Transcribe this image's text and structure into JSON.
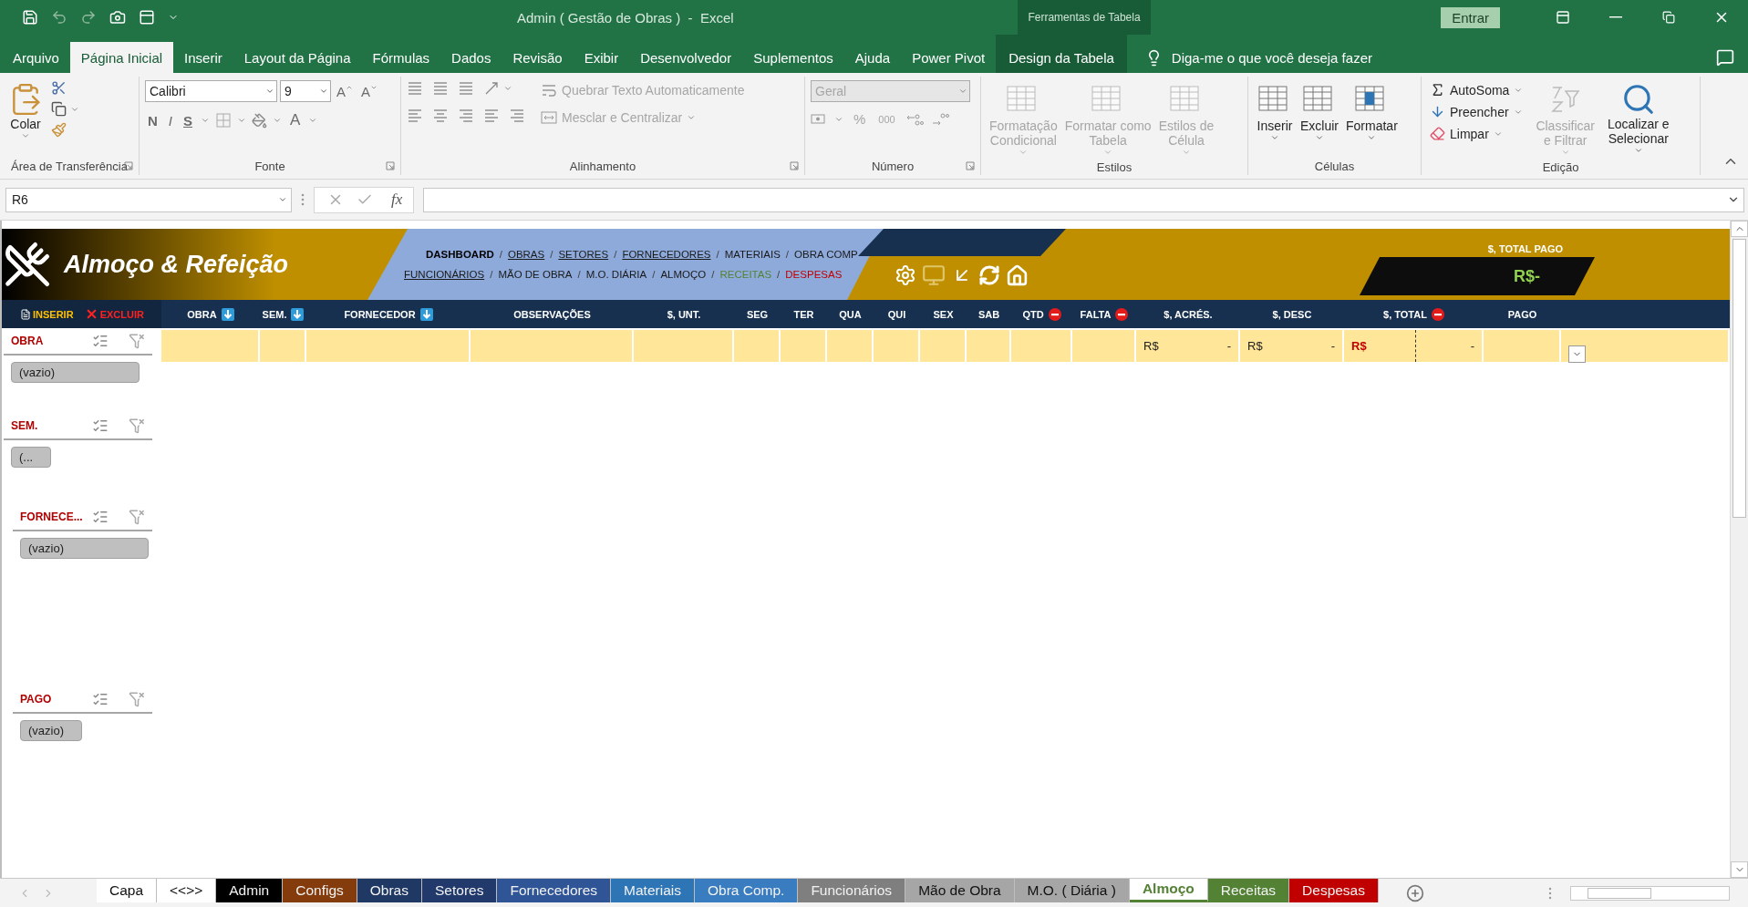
{
  "title_bar": {
    "title": "Admin ( Gestão de Obras )  -  Excel",
    "context_label": "Ferramentas de Tabela",
    "sign_in": "Entrar"
  },
  "menu_tabs": [
    {
      "label": "Arquivo",
      "selected": false,
      "kind": "normal"
    },
    {
      "label": "Página Inicial",
      "selected": true,
      "kind": "normal"
    },
    {
      "label": "Inserir",
      "selected": false,
      "kind": "normal"
    },
    {
      "label": "Layout da Página",
      "selected": false,
      "kind": "normal"
    },
    {
      "label": "Fórmulas",
      "selected": false,
      "kind": "normal"
    },
    {
      "label": "Dados",
      "selected": false,
      "kind": "normal"
    },
    {
      "label": "Revisão",
      "selected": false,
      "kind": "normal"
    },
    {
      "label": "Exibir",
      "selected": false,
      "kind": "normal"
    },
    {
      "label": "Desenvolvedor",
      "selected": false,
      "kind": "normal"
    },
    {
      "label": "Suplementos",
      "selected": false,
      "kind": "normal"
    },
    {
      "label": "Ajuda",
      "selected": false,
      "kind": "normal"
    },
    {
      "label": "Power Pivot",
      "selected": false,
      "kind": "normal"
    },
    {
      "label": "Design da Tabela",
      "selected": false,
      "kind": "contextual"
    }
  ],
  "tell_me": "Diga-me o que você deseja fazer",
  "ribbon": {
    "clipboard": {
      "paste": "Colar",
      "group": "Área de Transferência"
    },
    "font": {
      "font_name": "Calibri",
      "font_size": "9",
      "grow": "A",
      "shrink": "A",
      "bold": "N",
      "italic": "I",
      "underline": "S",
      "font_color": "A",
      "group": "Fonte"
    },
    "alignment": {
      "wrap": "Quebrar Texto Automaticamente",
      "merge": "Mesclar e Centralizar",
      "disabled": true,
      "group": "Alinhamento"
    },
    "number": {
      "format": "Geral",
      "percent": "%",
      "thousands": "000",
      "disabled": true,
      "group": "Número"
    },
    "styles": {
      "buttons": [
        {
          "lines": [
            "Formatação",
            "Condicional"
          ],
          "disabled": true
        },
        {
          "lines": [
            "Formatar como",
            "Tabela"
          ],
          "disabled": true
        },
        {
          "lines": [
            "Estilos de",
            "Célula"
          ],
          "disabled": true
        }
      ],
      "group": "Estilos"
    },
    "cells": {
      "buttons": [
        {
          "lines": [
            "Inserir"
          ],
          "disabled": false
        },
        {
          "lines": [
            "Excluir"
          ],
          "disabled": false
        },
        {
          "lines": [
            "Formatar"
          ],
          "disabled": false
        }
      ],
      "group": "Células"
    },
    "editing": {
      "small": [
        {
          "label": "AutoSoma"
        },
        {
          "label": "Preencher"
        },
        {
          "label": "Limpar"
        }
      ],
      "large": [
        {
          "lines": [
            "Classificar",
            "e Filtrar"
          ],
          "disabled": true
        },
        {
          "lines": [
            "Localizar e",
            "Selecionar"
          ],
          "disabled": false
        }
      ],
      "group": "Edição"
    }
  },
  "formula_bar": {
    "name_box": "R6",
    "fx": "fx"
  },
  "banner": {
    "title": "Almoço & Refeição",
    "nav_rows": [
      [
        {
          "label": "DASHBOARD",
          "underlined": false,
          "bold": true,
          "color": "#000000",
          "separator": "/"
        },
        {
          "label": "OBRAS",
          "underlined": true,
          "bold": false,
          "color": "#1a1a1a",
          "separator": "/"
        },
        {
          "label": "SETORES",
          "underlined": true,
          "bold": false,
          "color": "#1a1a1a",
          "separator": "/"
        },
        {
          "label": "FORNECEDORES",
          "underlined": true,
          "bold": false,
          "color": "#1a1a1a",
          "separator": "/"
        },
        {
          "label": "MATERIAIS",
          "underlined": false,
          "bold": false,
          "color": "#1a1a1a",
          "separator": "/"
        },
        {
          "label": "OBRA COMP",
          "underlined": false,
          "bold": false,
          "color": "#1a1a1a"
        }
      ],
      [
        {
          "label": "FUNCIONÁRIOS",
          "underlined": true,
          "bold": false,
          "color": "#1a1a1a",
          "separator": "/"
        },
        {
          "label": "MÃO DE OBRA",
          "underlined": false,
          "bold": false,
          "color": "#1a1a1a",
          "separator": "/"
        },
        {
          "label": "M.O. DIÁRIA",
          "underlined": false,
          "bold": false,
          "color": "#1a1a1a",
          "separator": "/"
        },
        {
          "label": "ALMOÇO",
          "underlined": false,
          "bold": false,
          "color": "#1a1a1a",
          "separator": "/"
        },
        {
          "label": "RECEITAS",
          "underlined": false,
          "bold": false,
          "color": "#548235",
          "separator": "/"
        },
        {
          "label": "DESPESAS",
          "underlined": false,
          "bold": false,
          "color": "#c00000"
        }
      ]
    ],
    "total_label": "$, TOTAL PAGO",
    "total_value": "R$-",
    "actions": [
      {
        "label": "INSERIR",
        "kind": "insert"
      },
      {
        "label": "EXCLUIR",
        "kind": "delete"
      }
    ]
  },
  "table": {
    "columns": [
      {
        "label": "OBRA",
        "kind": "sort"
      },
      {
        "label": "SEM.",
        "kind": "sort"
      },
      {
        "label": "FORNECEDOR",
        "kind": "sort"
      },
      {
        "label": "OBSERVAÇÕES",
        "kind": "plain"
      },
      {
        "label": "$, UNT.",
        "kind": "plain"
      },
      {
        "label": "SEG",
        "kind": "plain"
      },
      {
        "label": "TER",
        "kind": "plain"
      },
      {
        "label": "QUA",
        "kind": "plain"
      },
      {
        "label": "QUI",
        "kind": "plain"
      },
      {
        "label": "SEX",
        "kind": "plain"
      },
      {
        "label": "SAB",
        "kind": "plain"
      },
      {
        "label": "QTD",
        "kind": "stop"
      },
      {
        "label": "FALTA",
        "kind": "stop"
      },
      {
        "label": "$, ACRÉS.",
        "kind": "plain"
      },
      {
        "label": "$, DESC",
        "kind": "plain"
      },
      {
        "label": "$, TOTAL",
        "kind": "stop"
      },
      {
        "label": "PAGO",
        "kind": "plain"
      }
    ],
    "rows": [
      {
        "cells": [
          null,
          null,
          null,
          null,
          null,
          null,
          null,
          null,
          null,
          null,
          null,
          null,
          null,
          {
            "currency": "R$",
            "amount": "-",
            "alert": false
          },
          {
            "currency": "R$",
            "amount": "-",
            "alert": false
          },
          {
            "currency": "R$",
            "amount": "-",
            "alert": true
          },
          null
        ]
      }
    ]
  },
  "slicers": [
    {
      "title": "OBRA",
      "items": [
        {
          "label": "(vazio)",
          "selected": false
        }
      ]
    },
    {
      "title": "SEM.",
      "items": [
        {
          "label": "(...",
          "selected": false
        }
      ]
    },
    {
      "title": "FORNECE...",
      "items": [
        {
          "label": "(vazio)",
          "selected": false
        }
      ]
    },
    {
      "title": "PAGO",
      "items": [
        {
          "label": "(vazio)",
          "selected": false
        }
      ]
    }
  ],
  "sheet_tabs": [
    {
      "label": "Capa",
      "color": "#ffffff",
      "selected": false
    },
    {
      "label": "<<>>",
      "color": "#ffffff",
      "selected": false
    },
    {
      "label": "Admin",
      "color": "#000000",
      "selected": false
    },
    {
      "label": "Configs",
      "color": "#843c0c",
      "selected": false
    },
    {
      "label": "Obras",
      "color": "#1f3864",
      "selected": false
    },
    {
      "label": "Setores",
      "color": "#223a6b",
      "selected": false
    },
    {
      "label": "Fornecedores",
      "color": "#2f5597",
      "selected": false
    },
    {
      "label": "Materiais",
      "color": "#2e75b6",
      "selected": false
    },
    {
      "label": "Obra Comp.",
      "color": "#3a7cc0",
      "selected": false
    },
    {
      "label": "Funcionários",
      "color": "#7f7f7f",
      "selected": false
    },
    {
      "label": "Mão de Obra",
      "color": "#a6a6a6",
      "selected": false
    },
    {
      "label": "M.O. ( Diária )",
      "color": "#a6a6a6",
      "selected": false
    },
    {
      "label": "Almoço",
      "color": "#548235",
      "selected": true
    },
    {
      "label": "Receitas",
      "color": "#548235",
      "selected": false
    },
    {
      "label": "Despesas",
      "color": "#c00000",
      "selected": false
    }
  ]
}
